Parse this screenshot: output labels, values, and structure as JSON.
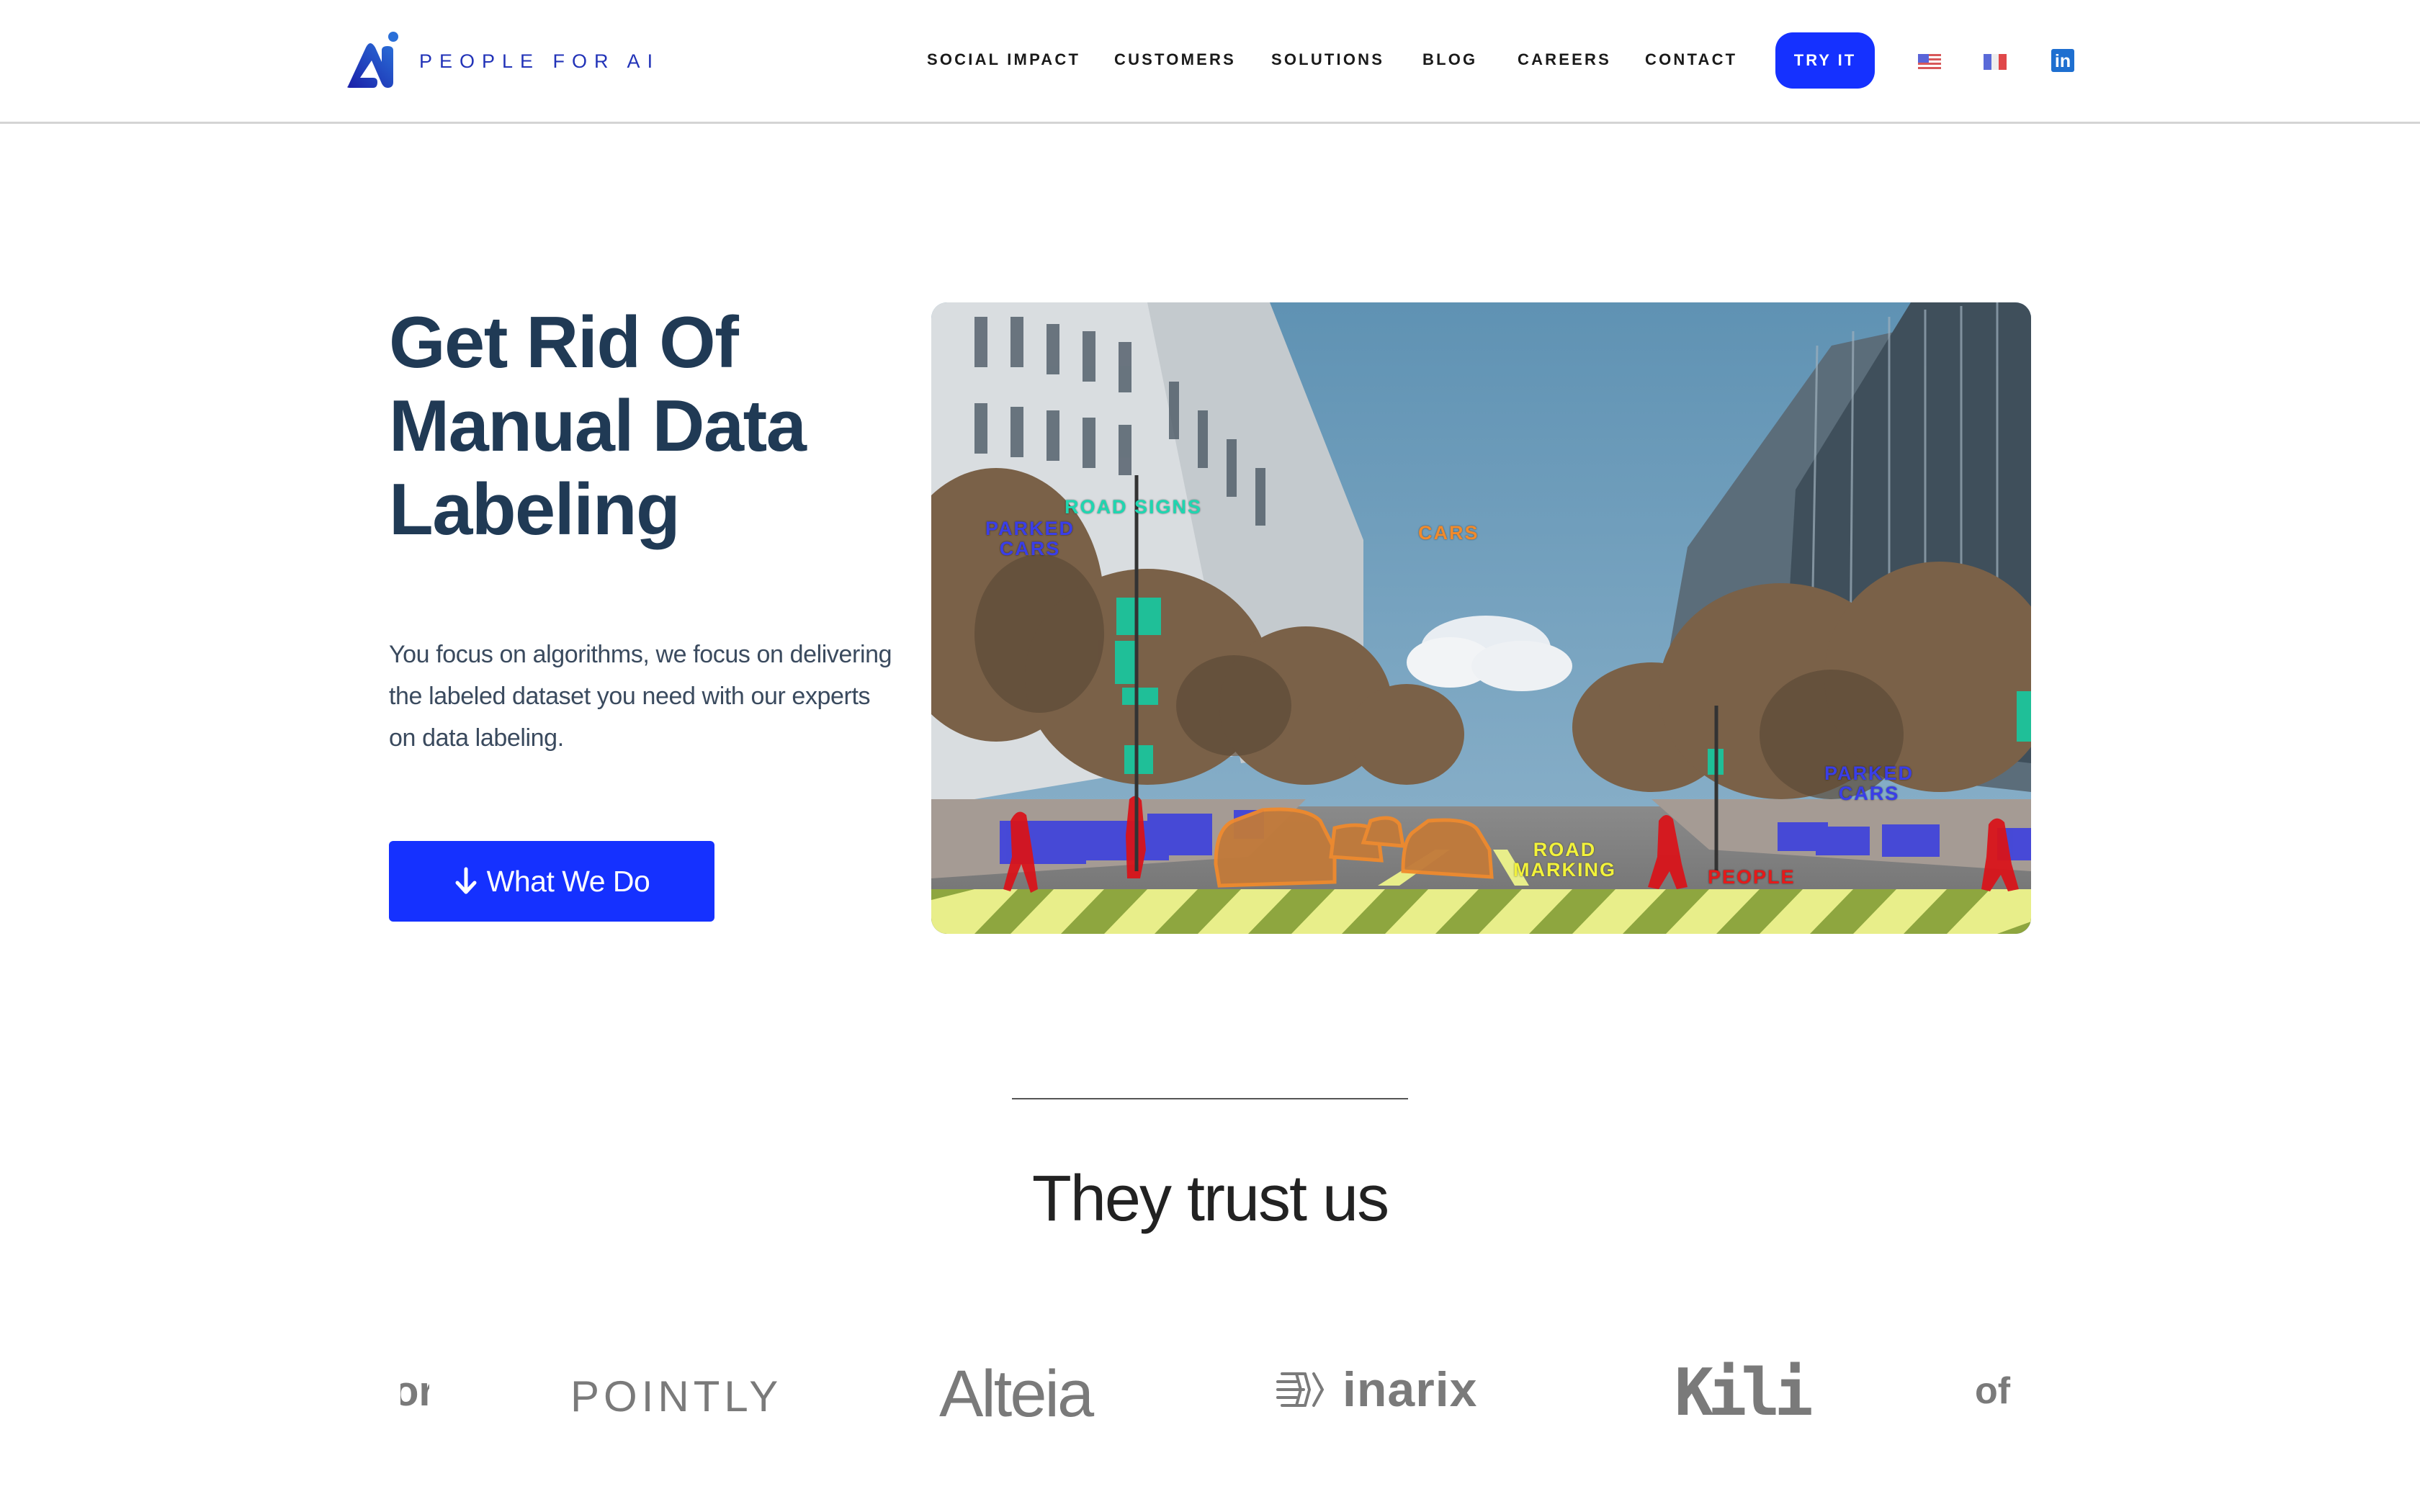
{
  "header": {
    "brand": "PEOPLE FOR AI",
    "nav": [
      {
        "label": "SOCIAL IMPACT"
      },
      {
        "label": "CUSTOMERS"
      },
      {
        "label": "SOLUTIONS"
      },
      {
        "label": "BLOG"
      },
      {
        "label": "CAREERS"
      },
      {
        "label": "CONTACT"
      }
    ],
    "cta_label": "TRY IT",
    "languages": [
      {
        "code": "en",
        "icon": "us-flag-icon"
      },
      {
        "code": "fr",
        "icon": "fr-flag-icon"
      }
    ],
    "social": {
      "label": "in",
      "icon": "linkedin-icon"
    }
  },
  "hero": {
    "title_lines": [
      "Get Rid Of",
      "Manual Data",
      "Labeling"
    ],
    "text": "You focus on algorithms, we focus on delivering the labeled dataset you need with our experts on data labeling.",
    "button_label": "What We Do",
    "button_icon": "arrow-down-icon",
    "image_labels": [
      {
        "text": "ROAD SIGNS",
        "color": "#1fd6b0"
      },
      {
        "text": "PARKED\nCARS",
        "color": "#3a3ee8"
      },
      {
        "text": "CARS",
        "color": "#f08a2c"
      },
      {
        "text": "ROAD\nMARKING",
        "color": "#f2f23a"
      },
      {
        "text": "PEOPLE",
        "color": "#e41a1a"
      },
      {
        "text": "PARKED\nCARS",
        "color": "#3a3ee8"
      }
    ]
  },
  "trust": {
    "title": "They trust us",
    "logos": [
      {
        "name": "partial-logo-left",
        "text": "or"
      },
      {
        "name": "pointly",
        "text": "POINTLY"
      },
      {
        "name": "alteia",
        "text": "Alteia"
      },
      {
        "name": "inarix",
        "text": "inarix"
      },
      {
        "name": "kili",
        "text": "Kili"
      },
      {
        "name": "partial-logo-right",
        "text": "of"
      }
    ]
  },
  "colors": {
    "brand_blue": "#1531ff",
    "heading": "#203a55",
    "logo_gray": "#7a7a7a"
  }
}
